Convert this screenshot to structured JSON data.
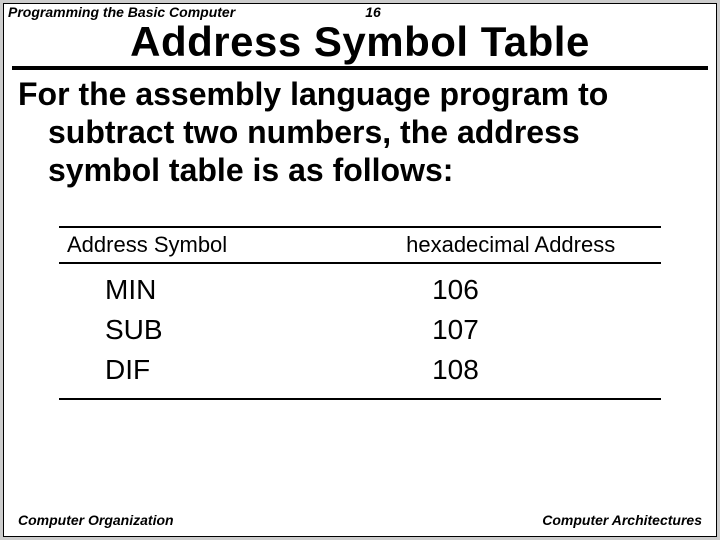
{
  "header": {
    "left": "Programming the Basic Computer",
    "page": "16"
  },
  "title": "Address Symbol Table",
  "body": {
    "line1": "For the assembly language program to",
    "line2": "subtract two numbers, the address",
    "line3": "symbol table is as follows:"
  },
  "table": {
    "headers": {
      "symbol": "Address Symbol",
      "hex": "hexadecimal Address"
    },
    "rows": [
      {
        "symbol": "MIN",
        "hex": "106"
      },
      {
        "symbol": "SUB",
        "hex": "107"
      },
      {
        "symbol": "DIF",
        "hex": "108"
      }
    ]
  },
  "footer": {
    "left": "Computer Organization",
    "right": "Computer Architectures"
  },
  "chart_data": {
    "type": "table",
    "title": "Address Symbol Table",
    "columns": [
      "Address Symbol",
      "hexadecimal Address"
    ],
    "rows": [
      [
        "MIN",
        "106"
      ],
      [
        "SUB",
        "107"
      ],
      [
        "DIF",
        "108"
      ]
    ]
  }
}
